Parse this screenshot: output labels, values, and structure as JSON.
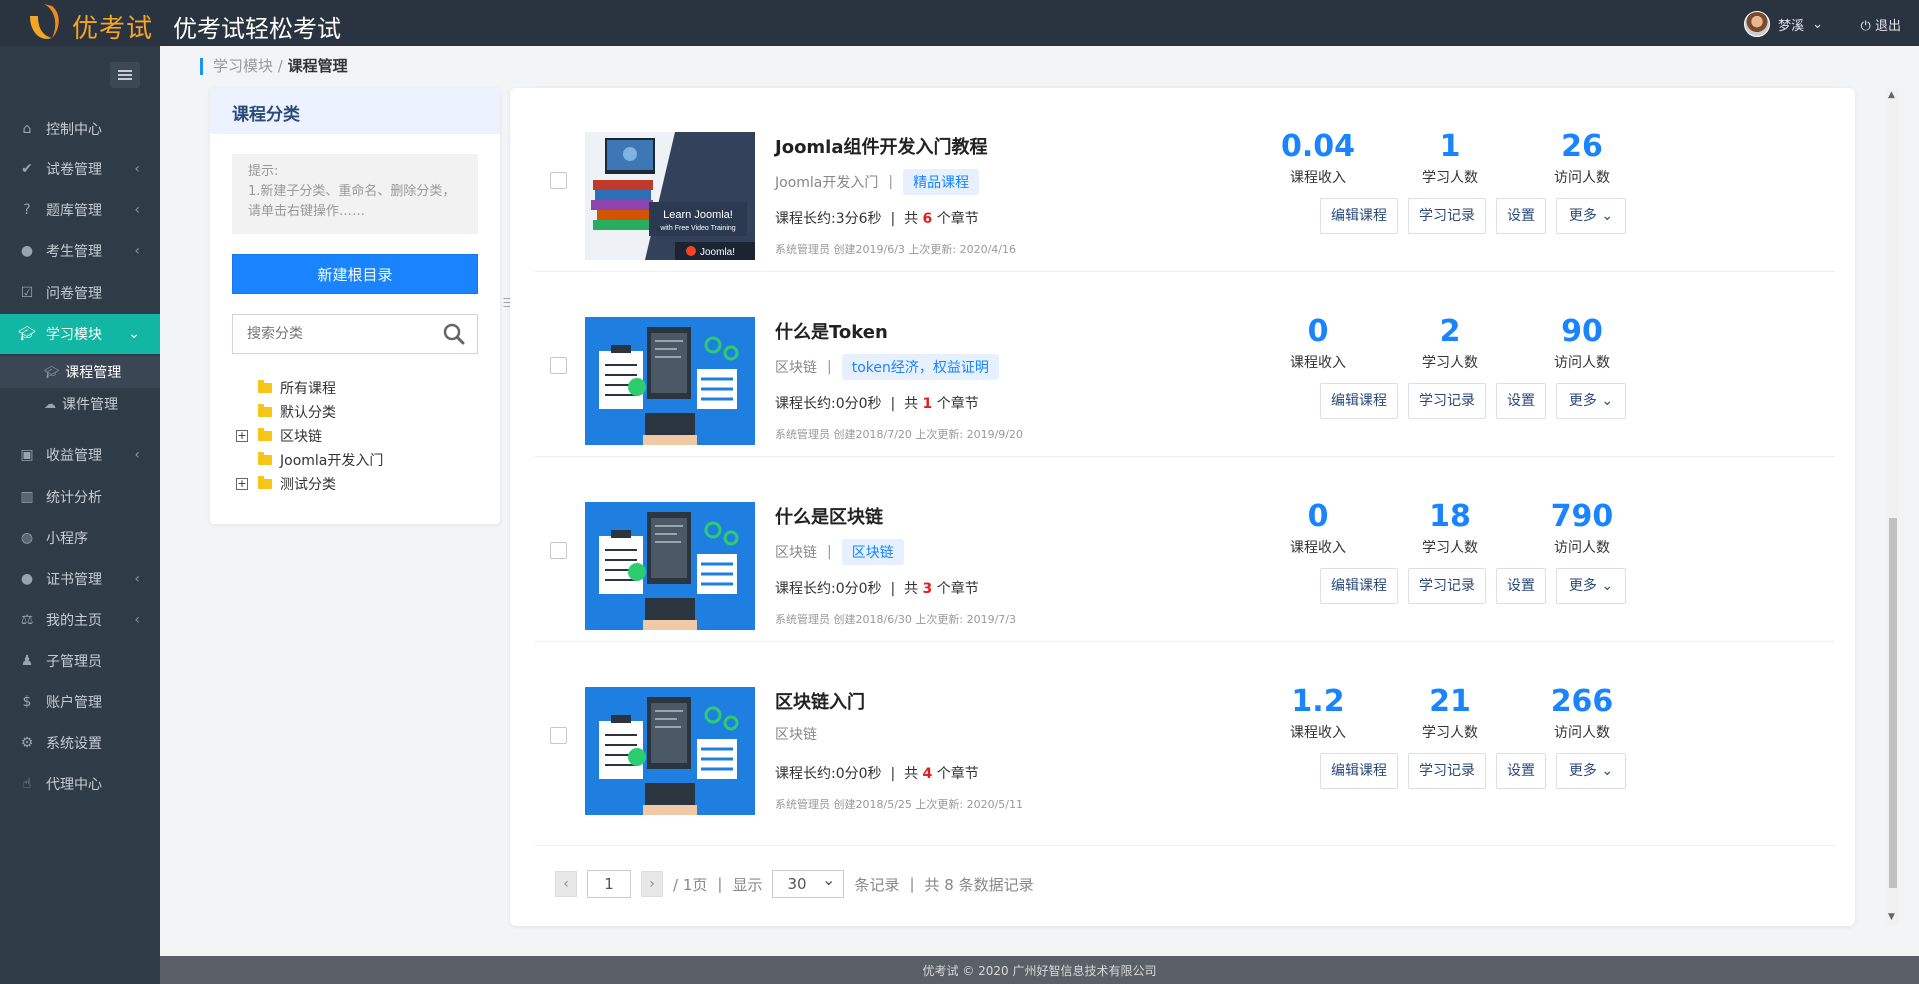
{
  "header": {
    "logo_text": "优考试",
    "app_title": "优考试轻松考试",
    "user_name": "梦溪",
    "logout_label": "退出"
  },
  "sidebar": {
    "items": [
      {
        "label": "控制中心",
        "icon": "home-icon"
      },
      {
        "label": "试卷管理",
        "icon": "check-circle-icon"
      },
      {
        "label": "题库管理",
        "icon": "question-circle-icon"
      },
      {
        "label": "考生管理",
        "icon": "user-icon"
      },
      {
        "label": "问卷管理",
        "icon": "checkbox-icon"
      },
      {
        "label": "学习模块",
        "icon": "graduation-cap-icon"
      },
      {
        "label": "收益管理",
        "icon": "money-icon"
      },
      {
        "label": "统计分析",
        "icon": "bar-chart-icon"
      },
      {
        "label": "小程序",
        "icon": "wechat-icon"
      },
      {
        "label": "证书管理",
        "icon": "certificate-icon"
      },
      {
        "label": "我的主页",
        "icon": "home-page-icon"
      },
      {
        "label": "子管理员",
        "icon": "admin-icon"
      },
      {
        "label": "账户管理",
        "icon": "dollar-icon"
      },
      {
        "label": "系统设置",
        "icon": "gear-icon"
      },
      {
        "label": "代理中心",
        "icon": "thumbs-up-icon"
      }
    ],
    "sub_items": [
      {
        "label": "课程管理"
      },
      {
        "label": "课件管理"
      }
    ],
    "active_color": "#12b7a4"
  },
  "breadcrumb": {
    "parent": "学习模块",
    "separator": "/",
    "current": "课程管理"
  },
  "category_panel": {
    "title": "课程分类",
    "tip_title": "提示:",
    "tip_text": "1.新建子分类、重命名、删除分类，请单击右键操作……",
    "new_root_label": "新建根目录",
    "search_placeholder": "搜索分类",
    "tree": [
      {
        "label": "所有课程",
        "expandable": false
      },
      {
        "label": "默认分类",
        "expandable": false
      },
      {
        "label": "区块链",
        "expandable": true,
        "toggle": "+"
      },
      {
        "label": "Joomla开发入门",
        "expandable": false
      },
      {
        "label": "测试分类",
        "expandable": true,
        "toggle": "+"
      }
    ]
  },
  "courses": [
    {
      "title": "Joomla组件开发入门教程",
      "category": "Joomla开发入门",
      "sep": "|",
      "tag": "精品课程",
      "length_label": "课程长约:",
      "length": "3分6秒",
      "chapters_prefix": "共",
      "chapters": "6",
      "chapters_suffix": "个章节",
      "meta": "系统管理员 创建2019/6/3 上次更新: 2020/4/16",
      "income": "0.04",
      "learners": "1",
      "visits": "26",
      "thumb": "joomla",
      "thumb_text1": "Learn Joomla!",
      "thumb_text2": "with Free Video Training",
      "thumb_brand": "Joomla!"
    },
    {
      "title": "什么是Token",
      "category": "区块链",
      "sep": "|",
      "tag": "token经济，权益证明",
      "length_label": "课程长约:",
      "length": "0分0秒",
      "chapters_prefix": "共",
      "chapters": "1",
      "chapters_suffix": "个章节",
      "meta": "系统管理员 创建2018/7/20 上次更新: 2019/9/20",
      "income": "0",
      "learners": "2",
      "visits": "90",
      "thumb": "blockchain"
    },
    {
      "title": "什么是区块链",
      "category": "区块链",
      "sep": "|",
      "tag": "区块链",
      "length_label": "课程长约:",
      "length": "0分0秒",
      "chapters_prefix": "共",
      "chapters": "3",
      "chapters_suffix": "个章节",
      "meta": "系统管理员 创建2018/6/30 上次更新: 2019/7/3",
      "income": "0",
      "learners": "18",
      "visits": "790",
      "thumb": "blockchain"
    },
    {
      "title": "区块链入门",
      "category": "区块链",
      "sep": "",
      "tag": "",
      "length_label": "课程长约:",
      "length": "0分0秒",
      "chapters_prefix": "共",
      "chapters": "4",
      "chapters_suffix": "个章节",
      "meta": "系统管理员 创建2018/5/25 上次更新: 2020/5/11",
      "income": "1.2",
      "learners": "21",
      "visits": "266",
      "thumb": "blockchain"
    }
  ],
  "labels": {
    "income": "课程收入",
    "learners": "学习人数",
    "visits": "访问人数",
    "edit": "编辑课程",
    "records": "学习记录",
    "settings": "设置",
    "more": "更多"
  },
  "pagination": {
    "prev_icon": "chevron-left-icon",
    "page_value": "1",
    "next_icon": "chevron-right-icon",
    "total_pages": "/ 1页",
    "show_label": "显示",
    "page_size": "30",
    "records_label": "条记录",
    "total_label": "共 8 条数据记录"
  },
  "footer": {
    "copyright": "优考试 © 2020 广州好智信息技术有限公司"
  },
  "colors": {
    "accent": "#1a84ff",
    "sidebar_bg": "#2f3b47",
    "topbar_bg": "#2a3440",
    "chapter_red": "#e02020"
  }
}
